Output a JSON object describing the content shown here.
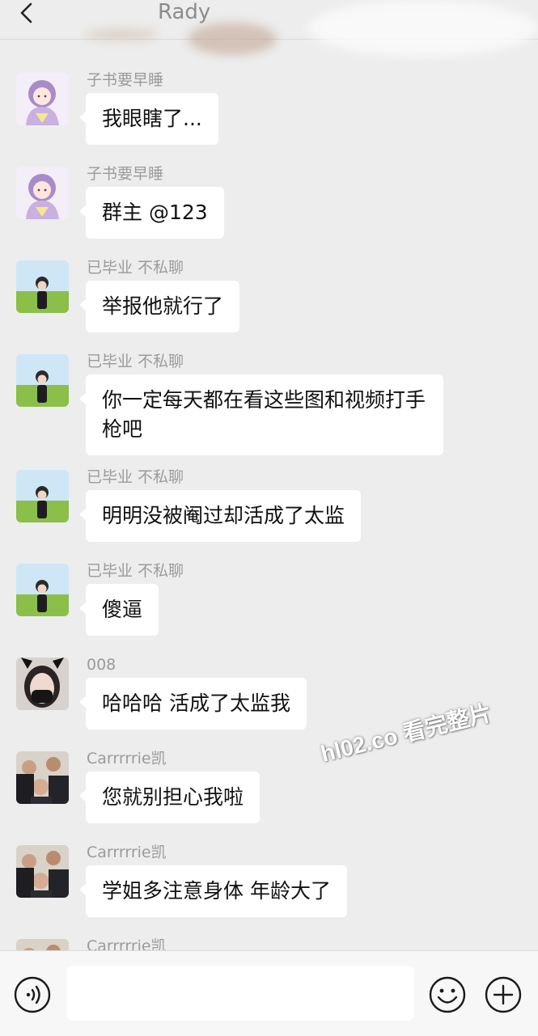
{
  "header": {
    "title": "Rady"
  },
  "messages": [
    {
      "sender": "子书要早睡",
      "text": "我眼瞎了...",
      "avatar": "anime-girl-avatar"
    },
    {
      "sender": "子书要早睡",
      "text": "群主 @123",
      "avatar": "anime-girl-avatar"
    },
    {
      "sender": "已毕业 不私聊",
      "text": "举报他就行了",
      "avatar": "field-girl-avatar"
    },
    {
      "sender": "已毕业 不私聊",
      "text": "你一定每天都在看这些图和视频打手枪吧",
      "avatar": "field-girl-avatar"
    },
    {
      "sender": "已毕业 不私聊",
      "text": "明明没被阉过却活成了太监",
      "avatar": "field-girl-avatar"
    },
    {
      "sender": "已毕业 不私聊",
      "text": "傻逼",
      "avatar": "field-girl-avatar"
    },
    {
      "sender": "008",
      "text": "哈哈哈 活成了太监我",
      "avatar": "masked-girl-avatar"
    },
    {
      "sender": "Carrrrrie凯",
      "text": "您就别担心我啦",
      "avatar": "group-photo-avatar"
    },
    {
      "sender": "Carrrrrie凯",
      "text": "学姐多注意身体 年龄大了",
      "avatar": "group-photo-avatar"
    },
    {
      "sender": "Carrrrrie凯",
      "text": "",
      "avatar": "group-photo-avatar"
    }
  ],
  "watermark": "hl02.co 看完整片",
  "input": {
    "value": "",
    "placeholder": ""
  },
  "icons": {
    "back": "chevron-left-icon",
    "voice": "voice-icon",
    "emoji": "emoji-icon",
    "plus": "plus-icon"
  }
}
